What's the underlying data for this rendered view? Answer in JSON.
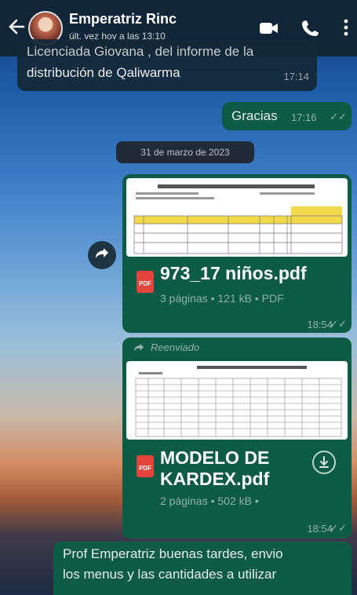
{
  "header": {
    "contact_name": "Emperatriz Rinc",
    "last_seen": "últ. vez hoy a las 13:10",
    "icons": [
      "back-arrow-icon",
      "avatar",
      "video-call-icon",
      "phone-icon",
      "more-vertical-icon"
    ]
  },
  "messages": {
    "m1": {
      "text_line1": "Licenciada Giovana , del informe de la",
      "text_line2": "distribución de Qaliwarma",
      "time": "17:14"
    },
    "m2": {
      "text": "Gracias",
      "time": "17:16"
    },
    "date_chip": "31 de marzo de 2023",
    "doc1": {
      "filename": "973_17 niños.pdf",
      "meta": "3 páginas • 121 kB • PDF",
      "time": "18:54"
    },
    "doc2": {
      "forwarded_label": "Reenviado",
      "filename_line1": "MODELO DE",
      "filename_line2": "KARDEX.pdf",
      "meta": "2 páginas • 502 kB •",
      "time": "18:54"
    },
    "m5": {
      "text_line1": "Prof Emperatriz buenas tardes, envio",
      "text_line2": "los menus y las cantidades a utilizar"
    }
  },
  "colors": {
    "header": "#102432",
    "incoming_bubble": "#122836",
    "outgoing_bubble": "#0c5b45",
    "pdf_red": "#e4443b"
  }
}
